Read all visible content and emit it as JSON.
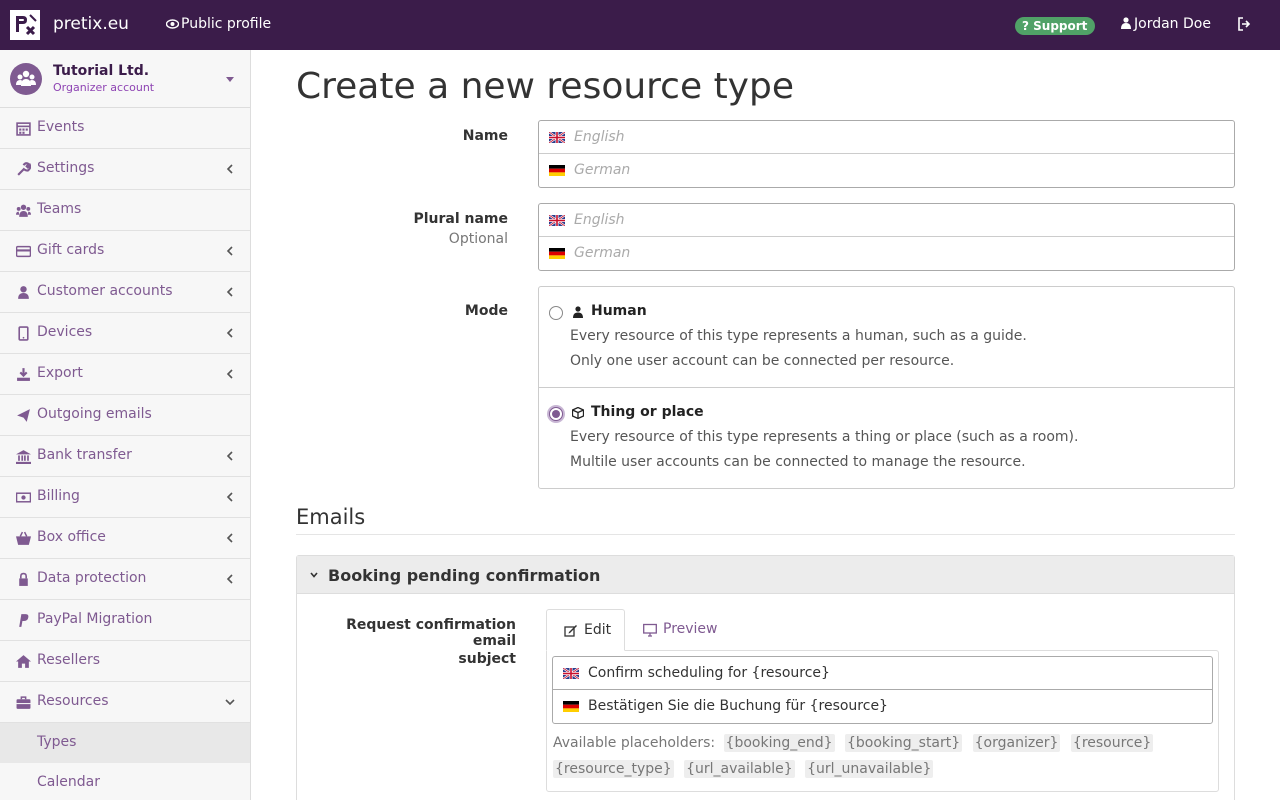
{
  "topbar": {
    "logo_text": "P\\X",
    "brand": "pretix.eu",
    "public_profile": "Public profile",
    "support": "Support",
    "user": "Jordan Doe"
  },
  "sidebar": {
    "org_name": "Tutorial Ltd.",
    "org_sub": "Organizer account",
    "items": [
      {
        "label": "Events",
        "icon": "calendar-icon",
        "chevron": false
      },
      {
        "label": "Settings",
        "icon": "wrench-icon",
        "chevron": true
      },
      {
        "label": "Teams",
        "icon": "users-icon",
        "chevron": false
      },
      {
        "label": "Gift cards",
        "icon": "credit-card-icon",
        "chevron": true
      },
      {
        "label": "Customer accounts",
        "icon": "user-icon",
        "chevron": true
      },
      {
        "label": "Devices",
        "icon": "tablet-icon",
        "chevron": true
      },
      {
        "label": "Export",
        "icon": "download-icon",
        "chevron": true
      },
      {
        "label": "Outgoing emails",
        "icon": "paper-plane-icon",
        "chevron": false
      },
      {
        "label": "Bank transfer",
        "icon": "bank-icon",
        "chevron": true
      },
      {
        "label": "Billing",
        "icon": "money-icon",
        "chevron": true
      },
      {
        "label": "Box office",
        "icon": "basket-icon",
        "chevron": true
      },
      {
        "label": "Data protection",
        "icon": "lock-icon",
        "chevron": true
      },
      {
        "label": "PayPal Migration",
        "icon": "paypal-icon",
        "chevron": false
      },
      {
        "label": "Resellers",
        "icon": "home-icon",
        "chevron": false
      },
      {
        "label": "Resources",
        "icon": "briefcase-icon",
        "chevron": "down"
      }
    ],
    "subitems": [
      {
        "label": "Types",
        "active": true
      },
      {
        "label": "Calendar",
        "active": false
      }
    ]
  },
  "page": {
    "title": "Create a new resource type"
  },
  "form": {
    "name_label": "Name",
    "plural_label": "Plural name",
    "plural_sub": "Optional",
    "mode_label": "Mode",
    "english_placeholder": "English",
    "german_placeholder": "German",
    "mode_human_title": "Human",
    "mode_human_desc1": "Every resource of this type represents a human, such as a guide.",
    "mode_human_desc2": "Only one user account can be connected per resource.",
    "mode_thing_title": "Thing or place",
    "mode_thing_desc1": "Every resource of this type represents a thing or place (such as a room).",
    "mode_thing_desc2": "Multile user accounts can be connected to manage the resource."
  },
  "emails": {
    "section_title": "Emails",
    "panel_title": "Booking pending confirmation",
    "subject_label_1": "Request confirmation email",
    "subject_label_2": "subject",
    "tab_edit": "Edit",
    "tab_preview": "Preview",
    "subject_en": "Confirm scheduling for {resource}",
    "subject_de": "Bestätigen Sie die Buchung für {resource}",
    "placeholders_label": "Available placeholders:",
    "placeholders": [
      "{booking_end}",
      "{booking_start}",
      "{organizer}",
      "{resource}",
      "{resource_type}",
      "{url_available}",
      "{url_unavailable}"
    ]
  },
  "colors": {
    "brand": "#3b1c4a",
    "accent": "#7f5a91",
    "support": "#50a167"
  }
}
